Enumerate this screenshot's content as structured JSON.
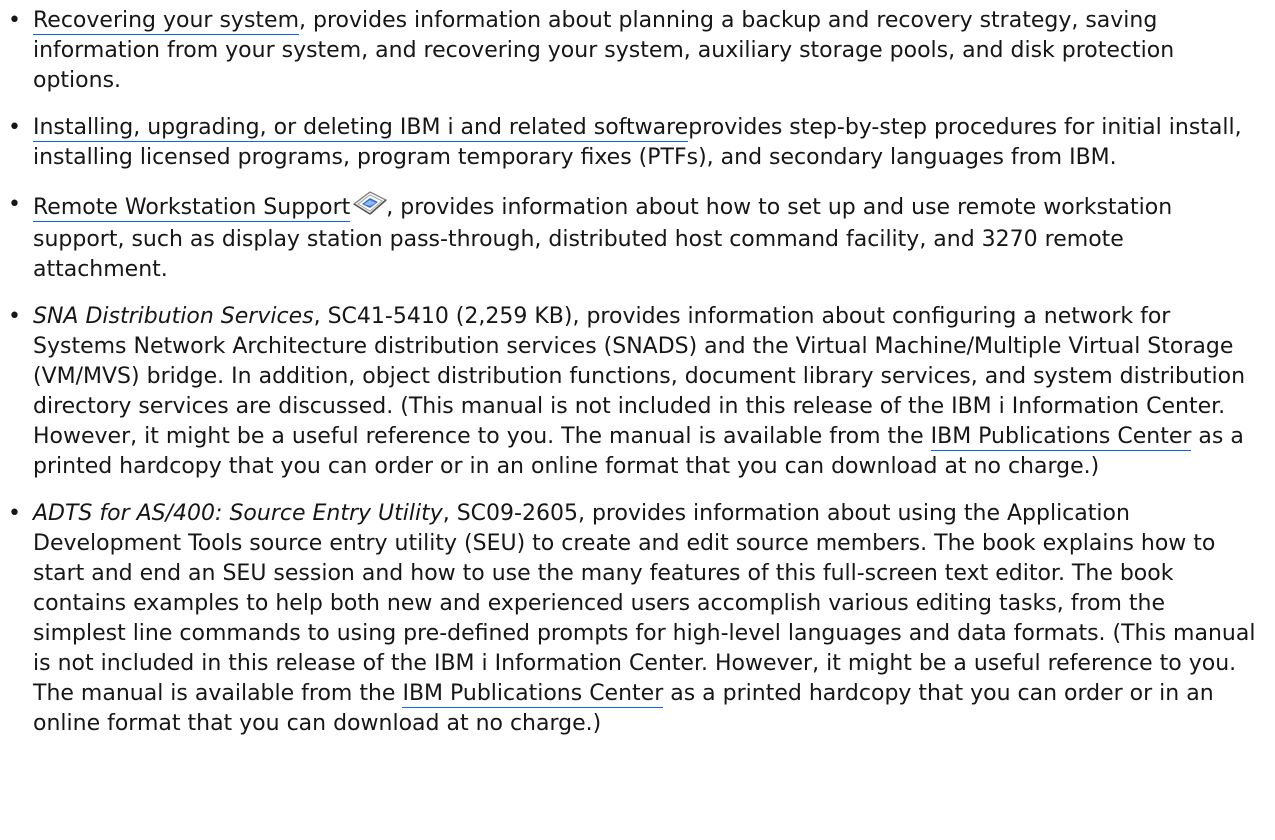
{
  "items": [
    {
      "link": "Recovering your system",
      "text": ", provides information about planning a backup and recovery strategy, saving information from your system, and recovering your system, auxiliary storage pools, and disk protection options."
    },
    {
      "link": "Installing, upgrading, or deleting IBM i and related software",
      "text": "provides step-by-step procedures for initial install, installing licensed programs, program temporary fixes (PTFs), and secondary languages from IBM."
    },
    {
      "link": "Remote Workstation Support",
      "icon": "external-pdf-icon",
      "text": ", provides information about how to set up and use remote workstation support, such as display station pass-through, distributed host command facility, and 3270 remote attachment."
    },
    {
      "title": "SNA Distribution Services",
      "text_before_link": ", SC41-5410 (2,259 KB), provides information about configuring a network for Systems Network Architecture distribution services (SNADS) and the Virtual Machine/Multiple Virtual Storage (VM/MVS) bridge. In addition, object distribution functions, document library services, and system distribution directory services are discussed. (This manual is not included in this release of the IBM i Information Center. However, it might be a useful reference to you. The manual is available from the ",
      "link": "IBM Publications Center",
      "text_after_link": " as a printed hardcopy that you can order or in an online format that you can download at no charge.)"
    },
    {
      "title": "ADTS for AS/400: Source Entry Utility",
      "text_before_link": ", SC09-2605, provides information about using the Application Development Tools source entry utility (SEU) to create and edit source members. The book explains how to start and end an SEU session and how to use the many features of this full-screen text editor. The book contains examples to help both new and experienced users accomplish various editing tasks, from the simplest line commands to using pre-defined prompts for high-level languages and data formats. (This manual is not included in this release of the IBM i Information Center. However, it might be a useful reference to you. The manual is available from the ",
      "link": "IBM Publications Center",
      "text_after_link": " as a printed hardcopy that you can order or in an online format that you can download at no charge.)"
    }
  ],
  "colors": {
    "text": "#161616",
    "link_underline": "#0f62fe"
  }
}
